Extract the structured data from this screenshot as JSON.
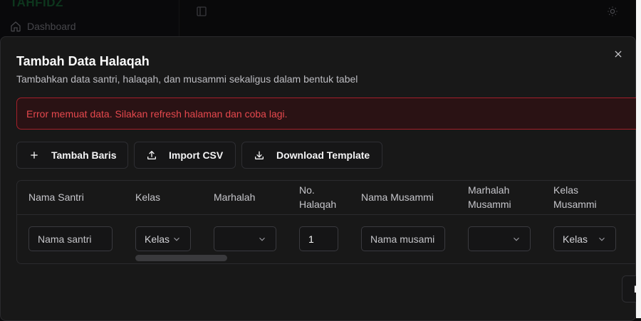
{
  "app": {
    "brand": "TAHFIDZ"
  },
  "sidebar": {
    "items": [
      {
        "label": "Dashboard",
        "icon": "home-icon"
      }
    ]
  },
  "dialog": {
    "title": "Tambah Data Halaqah",
    "description": "Tambahkan data santri, halaqah, dan musammi sekaligus dalam bentuk tabel",
    "error": "Error memuat data. Silakan refresh halaman dan coba lagi.",
    "toolbar": {
      "add_row": "Tambah Baris",
      "import_csv": "Import CSV",
      "download_template": "Download Template"
    },
    "table": {
      "headers": {
        "nama_santri": "Nama Santri",
        "kelas": "Kelas",
        "marhalah": "Marhalah",
        "no_halaqah_1": "No.",
        "no_halaqah_2": "Halaqah",
        "nama_musammi": "Nama Musammi",
        "marhalah_musammi_1": "Marhalah",
        "marhalah_musammi_2": "Musammi",
        "kelas_musammi_1": "Kelas",
        "kelas_musammi_2": "Musammi"
      },
      "row": {
        "nama_santri_placeholder": "Nama santri",
        "kelas_value": "Kelas",
        "marhalah_value": "",
        "no_halaqah_value": "1",
        "nama_musammi_placeholder": "Nama musami",
        "marhalah_musammi_value": "",
        "kelas_musammi_value": "Kelas"
      }
    },
    "footer_button_partial": "B"
  },
  "colors": {
    "error": "#e5484d",
    "error_border": "#a3202a",
    "brand": "#14532d"
  }
}
